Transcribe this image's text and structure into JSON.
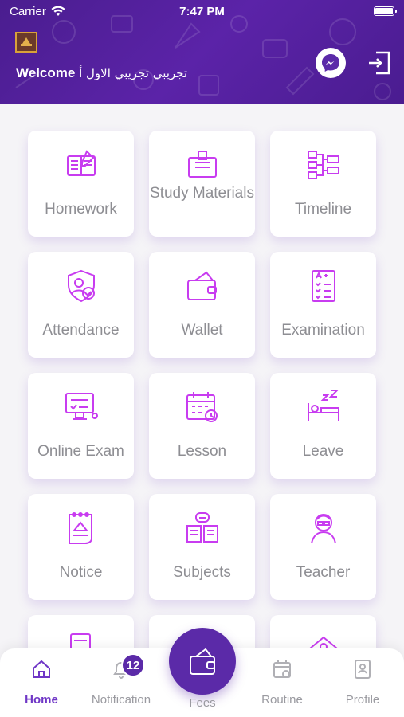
{
  "status": {
    "carrier": "Carrier",
    "time": "7:47 PM"
  },
  "header": {
    "welcome_label": "Welcome",
    "user_name": "تجريبي تجريبي الاول أ"
  },
  "grid": [
    {
      "label": "Homework",
      "icon": "homework-icon"
    },
    {
      "label": "Study Materials",
      "icon": "study-materials-icon"
    },
    {
      "label": "Timeline",
      "icon": "timeline-icon"
    },
    {
      "label": "Attendance",
      "icon": "attendance-icon"
    },
    {
      "label": "Wallet",
      "icon": "wallet-icon"
    },
    {
      "label": "Examination",
      "icon": "examination-icon"
    },
    {
      "label": "Online Exam",
      "icon": "online-exam-icon"
    },
    {
      "label": "Lesson",
      "icon": "lesson-icon"
    },
    {
      "label": "Leave",
      "icon": "leave-icon"
    },
    {
      "label": "Notice",
      "icon": "notice-icon"
    },
    {
      "label": "Subjects",
      "icon": "subjects-icon"
    },
    {
      "label": "Teacher",
      "icon": "teacher-icon"
    }
  ],
  "tabs": {
    "home": "Home",
    "notification": "Notification",
    "notification_count": "12",
    "fees": "Fees",
    "routine": "Routine",
    "profile": "Profile"
  },
  "colors": {
    "primary": "#5b2aa8",
    "icon": "#c83cf0",
    "label": "#8e8e93"
  }
}
